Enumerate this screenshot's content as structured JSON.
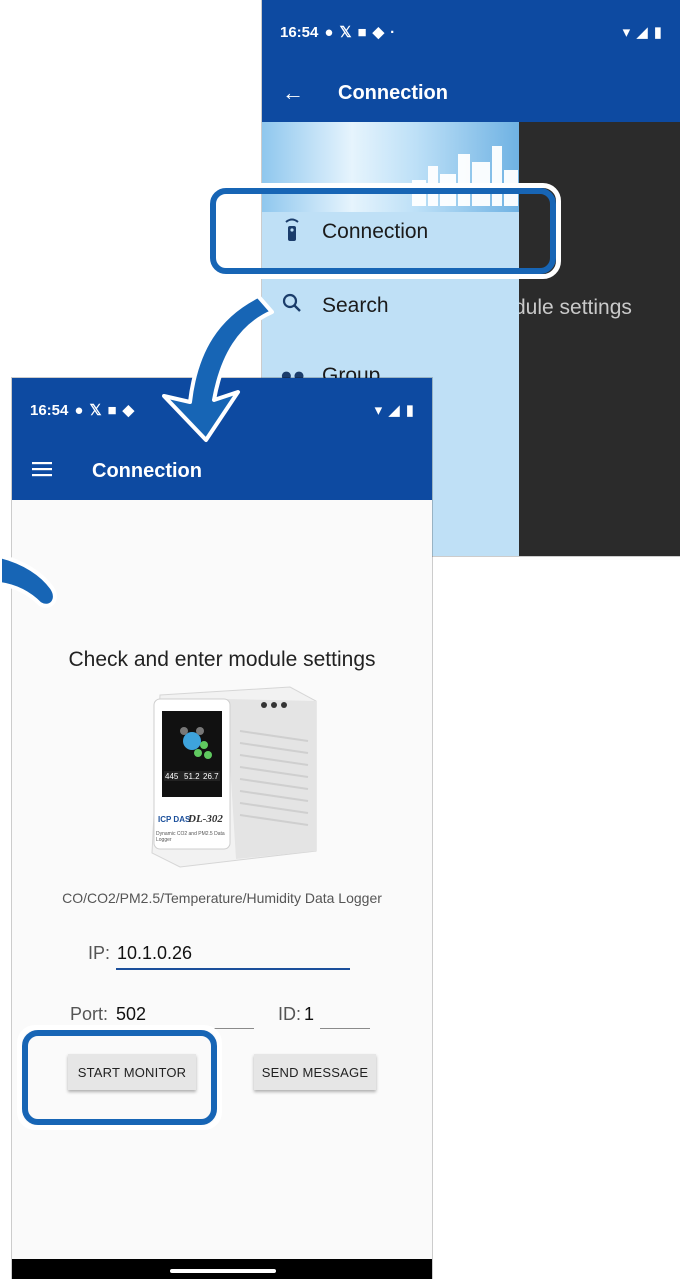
{
  "back_screen": {
    "status_time": "16:54",
    "status_icons": [
      "facebook-icon",
      "x-icon",
      "youtube-icon",
      "chat-icon",
      "dot-icon"
    ],
    "status_right_icons": [
      "wifi-icon",
      "signal-icon",
      "battery-icon"
    ],
    "appbar_title": "Connection",
    "drawer_items": [
      {
        "label": "Connection",
        "icon": "remote-icon"
      },
      {
        "label": "Search",
        "icon": "search-icon"
      },
      {
        "label": "Group",
        "icon": "group-icon"
      }
    ],
    "overlay_text": "dule settings"
  },
  "front_screen": {
    "status_time": "16:54",
    "appbar_title": "Connection",
    "heading": "Check and enter module settings",
    "device_label": "DL-302",
    "device_brand": "ICP DAS",
    "device_subtitle": "Dynamic CO2 and PM2.5 Data Logger",
    "device_screen_values": [
      "445",
      "51.2",
      "26.7"
    ],
    "caption": "CO/CO2/PM2.5/Temperature/Humidity Data Logger",
    "ip_label": "IP:",
    "ip_value": "10.1.0.26",
    "port_label": "Port:",
    "port_value": "502",
    "id_label": "ID:",
    "id_value": "1",
    "start_button": "START MONITOR",
    "send_button": "SEND MESSAGE"
  },
  "colors": {
    "appbar": "#0d4aa1",
    "callout": "#1765b5",
    "drawer": "#bfe0f6"
  }
}
